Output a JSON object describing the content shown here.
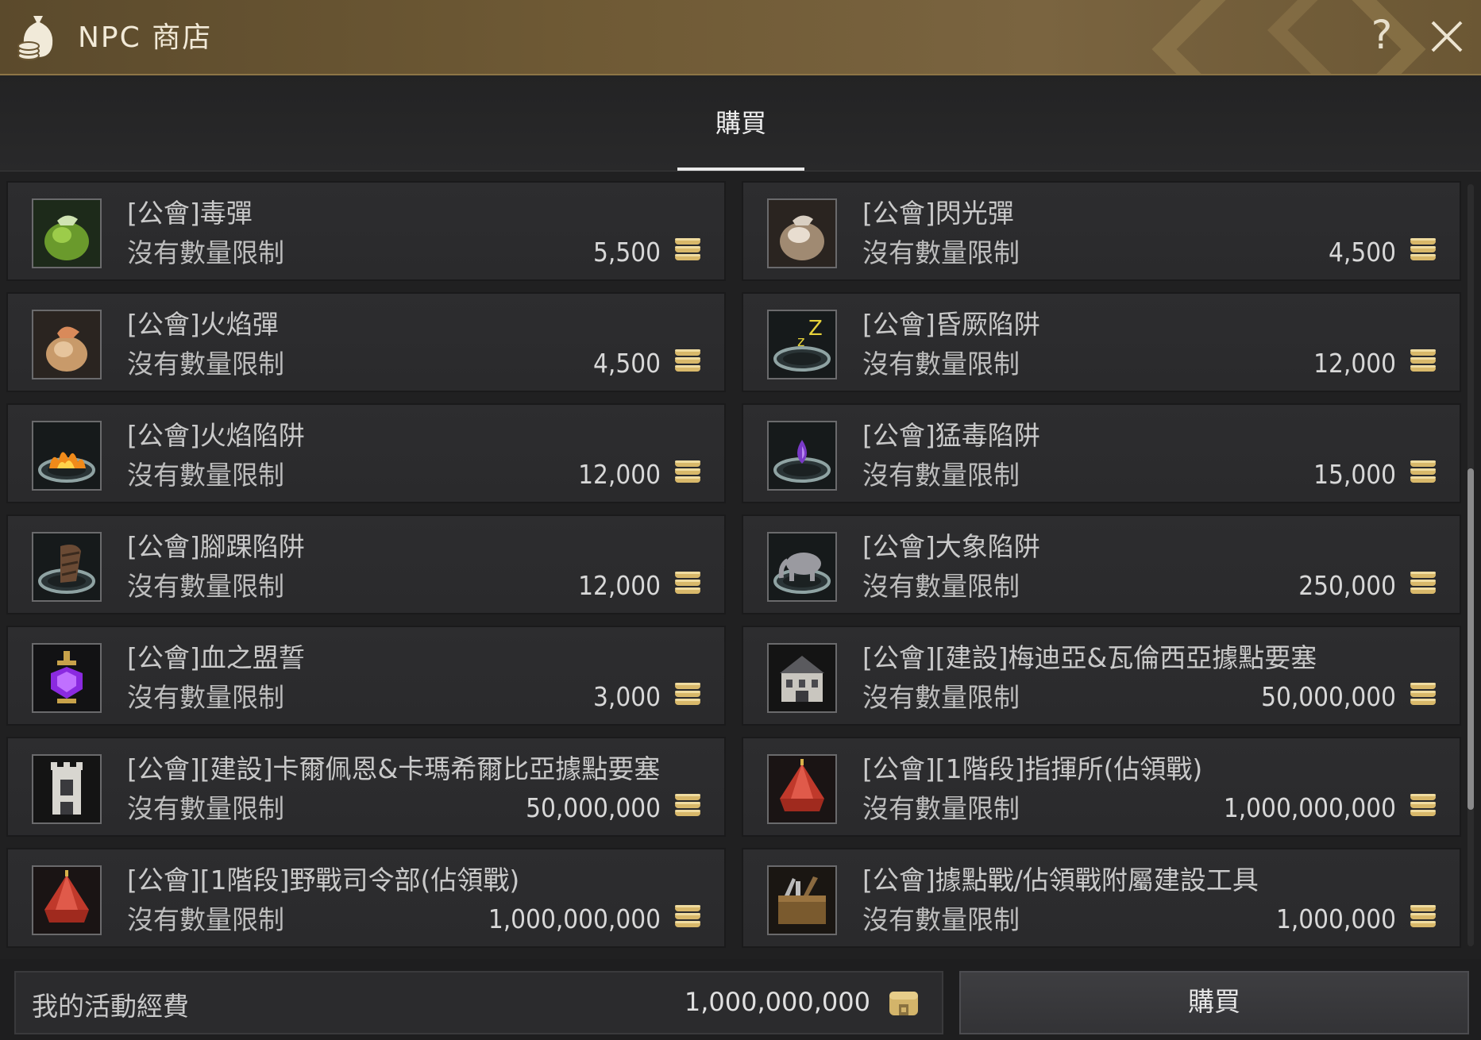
{
  "window": {
    "title": "NPC 商店",
    "help_label": "?"
  },
  "tabs": [
    {
      "label": "購買",
      "active": true
    }
  ],
  "items": [
    {
      "name": "[公會]毒彈",
      "limit": "沒有數量限制",
      "price": "5,500",
      "icon": "green-pouch-icon"
    },
    {
      "name": "[公會]閃光彈",
      "limit": "沒有數量限制",
      "price": "4,500",
      "icon": "white-pouch-icon"
    },
    {
      "name": "[公會]火焰彈",
      "limit": "沒有數量限制",
      "price": "4,500",
      "icon": "tan-pouch-icon"
    },
    {
      "name": "[公會]昏厥陷阱",
      "limit": "沒有數量限制",
      "price": "12,000",
      "icon": "stun-trap-icon"
    },
    {
      "name": "[公會]火焰陷阱",
      "limit": "沒有數量限制",
      "price": "12,000",
      "icon": "fire-trap-icon"
    },
    {
      "name": "[公會]猛毒陷阱",
      "limit": "沒有數量限制",
      "price": "15,000",
      "icon": "poison-trap-icon"
    },
    {
      "name": "[公會]腳踝陷阱",
      "limit": "沒有數量限制",
      "price": "12,000",
      "icon": "ankle-trap-icon"
    },
    {
      "name": "[公會]大象陷阱",
      "limit": "沒有數量限制",
      "price": "250,000",
      "icon": "elephant-trap-icon"
    },
    {
      "name": "[公會]血之盟誓",
      "limit": "沒有數量限制",
      "price": "3,000",
      "icon": "purple-potion-icon"
    },
    {
      "name": "[公會][建設]梅迪亞&瓦倫西亞據點要塞",
      "limit": "沒有數量限制",
      "price": "50,000,000",
      "icon": "fortress-icon"
    },
    {
      "name": "[公會][建設]卡爾佩恩&卡瑪希爾比亞據點要塞",
      "limit": "沒有數量限制",
      "price": "50,000,000",
      "icon": "fortress-tower-icon"
    },
    {
      "name": "[公會][1階段]指揮所(佔領戰)",
      "limit": "沒有數量限制",
      "price": "1,000,000,000",
      "icon": "red-tent-icon"
    },
    {
      "name": "[公會][1階段]野戰司令部(佔領戰)",
      "limit": "沒有數量限制",
      "price": "1,000,000,000",
      "icon": "red-tent-icon"
    },
    {
      "name": "[公會]據點戰/佔領戰附屬建設工具",
      "limit": "沒有數量限制",
      "price": "1,000,000",
      "icon": "toolbox-icon"
    }
  ],
  "footer": {
    "funds_label": "我的活動經費",
    "funds_value": "1,000,000,000",
    "buy_label": "購買"
  }
}
